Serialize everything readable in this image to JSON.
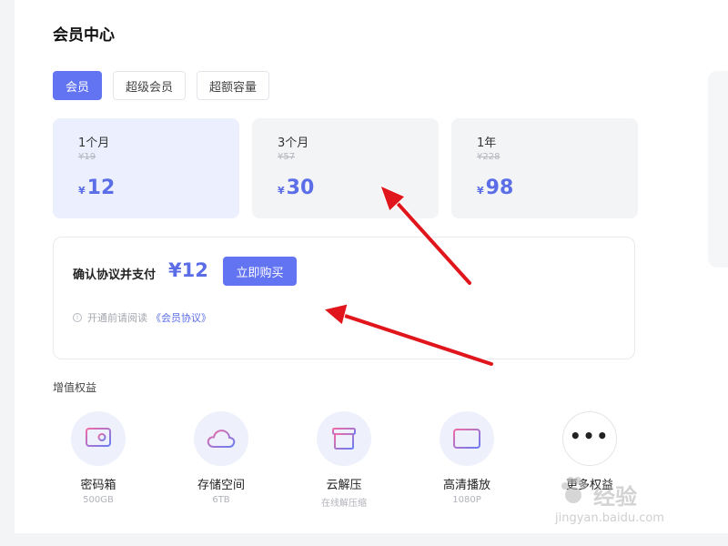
{
  "page": {
    "title": "会员中心"
  },
  "tabs": [
    {
      "label": "会员",
      "active": true
    },
    {
      "label": "超级会员",
      "active": false
    },
    {
      "label": "超额容量",
      "active": false
    }
  ],
  "plans": [
    {
      "duration": "1个月",
      "original_price": "¥19",
      "currency": "¥",
      "price": "12",
      "selected": true
    },
    {
      "duration": "3个月",
      "original_price": "¥57",
      "currency": "¥",
      "price": "30",
      "selected": false
    },
    {
      "duration": "1年",
      "original_price": "¥228",
      "currency": "¥",
      "price": "98",
      "selected": false
    }
  ],
  "payment": {
    "label": "确认协议并支付",
    "amount": "¥12",
    "buy_label": "立即购买",
    "notice_prefix": "开通前请阅读",
    "agreement_link": "《会员协议》"
  },
  "benefits": {
    "section_title": "增值权益",
    "items": [
      {
        "name": "密码箱",
        "desc": "500GB",
        "icon": "safe-icon"
      },
      {
        "name": "存储空间",
        "desc": "6TB",
        "icon": "cloud-icon"
      },
      {
        "name": "云解压",
        "desc": "在线解压缩",
        "icon": "archive-icon"
      },
      {
        "name": "高清播放",
        "desc": "1080P",
        "icon": "card-icon"
      },
      {
        "name": "更多权益",
        "desc": "",
        "icon": "more-dots-icon"
      }
    ]
  },
  "watermark": {
    "brand": "经验",
    "url": "jingyan.baidu.com"
  },
  "colors": {
    "accent": "#6374f2",
    "price": "#5b6ee8",
    "arrow": "#e0161c"
  }
}
